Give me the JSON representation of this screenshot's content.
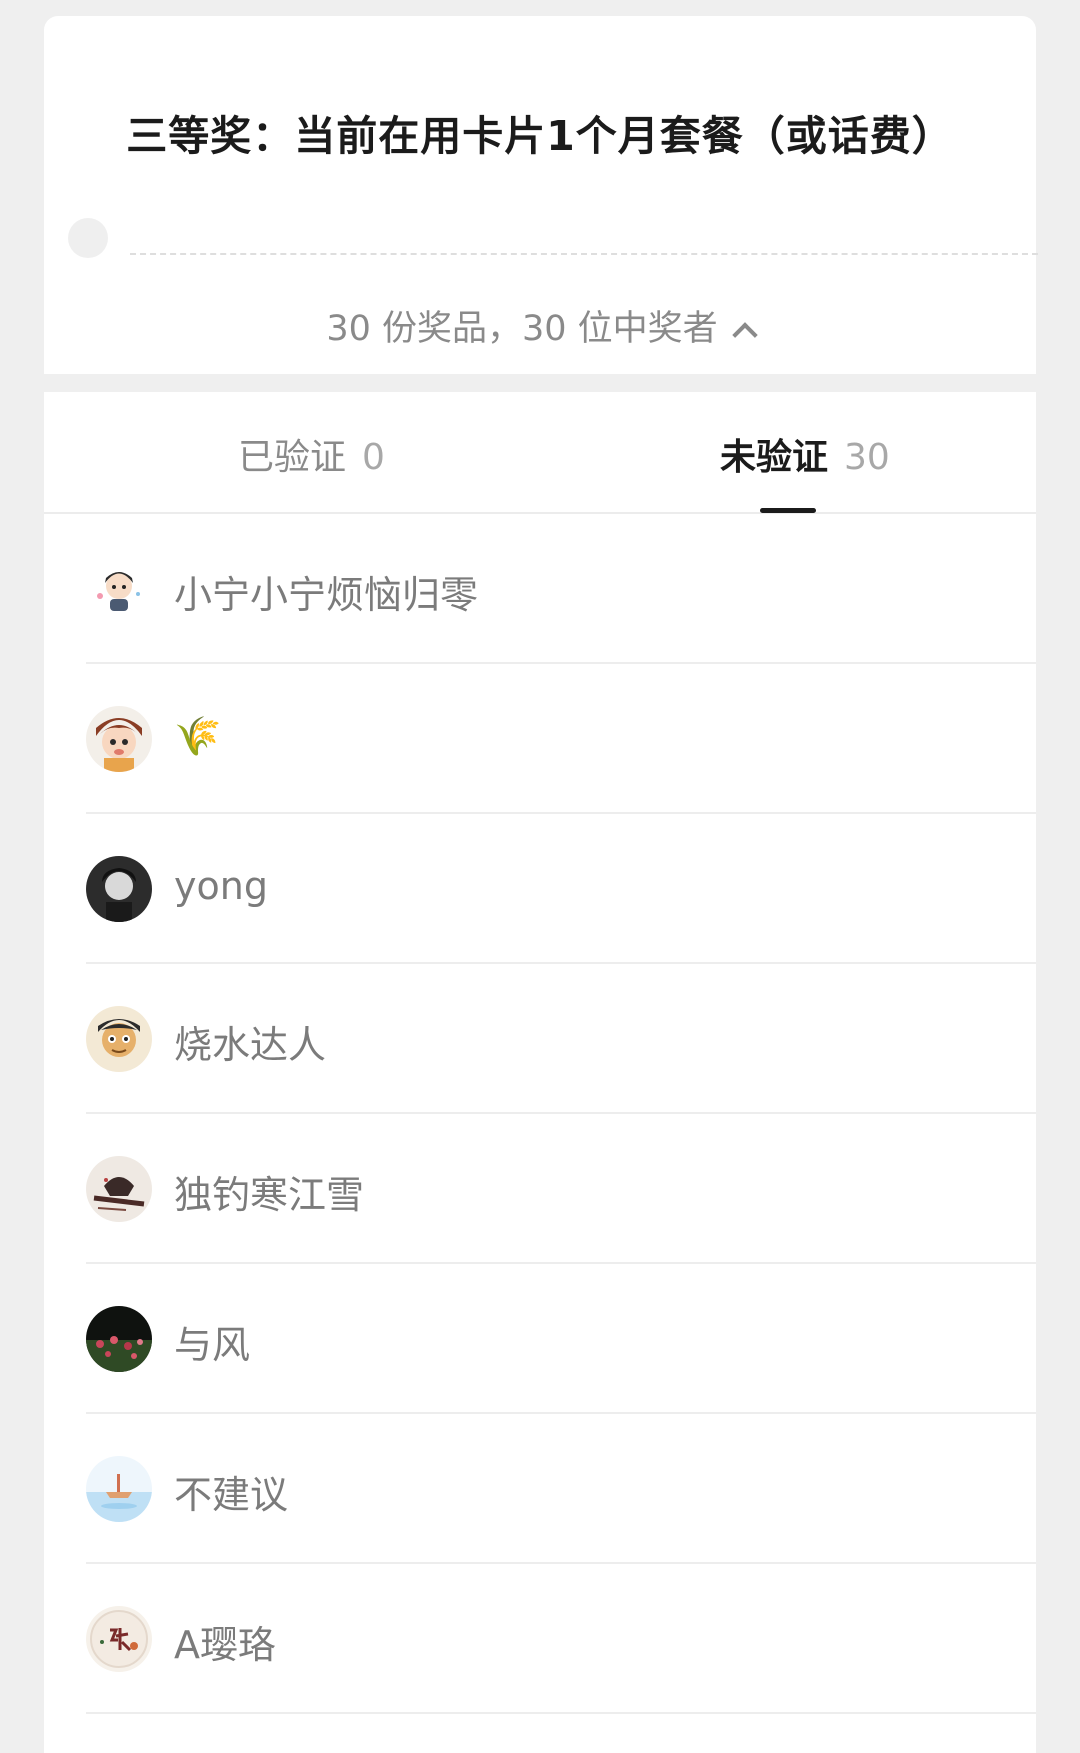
{
  "prize": {
    "title": "三等奖：当前在用卡片1个月套餐（或话费）",
    "summary": "30 份奖品，30 位中奖者"
  },
  "tabs": [
    {
      "label": "已验证",
      "count": "0",
      "active": false
    },
    {
      "label": "未验证",
      "count": "30",
      "active": true
    }
  ],
  "winners": [
    {
      "name": "小宁小宁烦恼归零",
      "avatar": "cartoon-boy-avatar"
    },
    {
      "name": "🌾",
      "avatar": "cartoon-kid-avatar"
    },
    {
      "name": "yong",
      "avatar": "photo-person-avatar"
    },
    {
      "name": "烧水达人",
      "avatar": "cartoon-king-avatar"
    },
    {
      "name": "独钓寒江雪",
      "avatar": "ink-painting-avatar"
    },
    {
      "name": "与风",
      "avatar": "flowers-night-avatar"
    },
    {
      "name": "不建议",
      "avatar": "seascape-avatar"
    },
    {
      "name": "A璎珞",
      "avatar": "calligraphy-avatar"
    }
  ],
  "colors": {
    "background": "#efefef",
    "card": "#ffffff",
    "title": "#1b1b1b",
    "muted": "#8a8a8a",
    "active_tab_indicator": "#1b1b1b"
  }
}
